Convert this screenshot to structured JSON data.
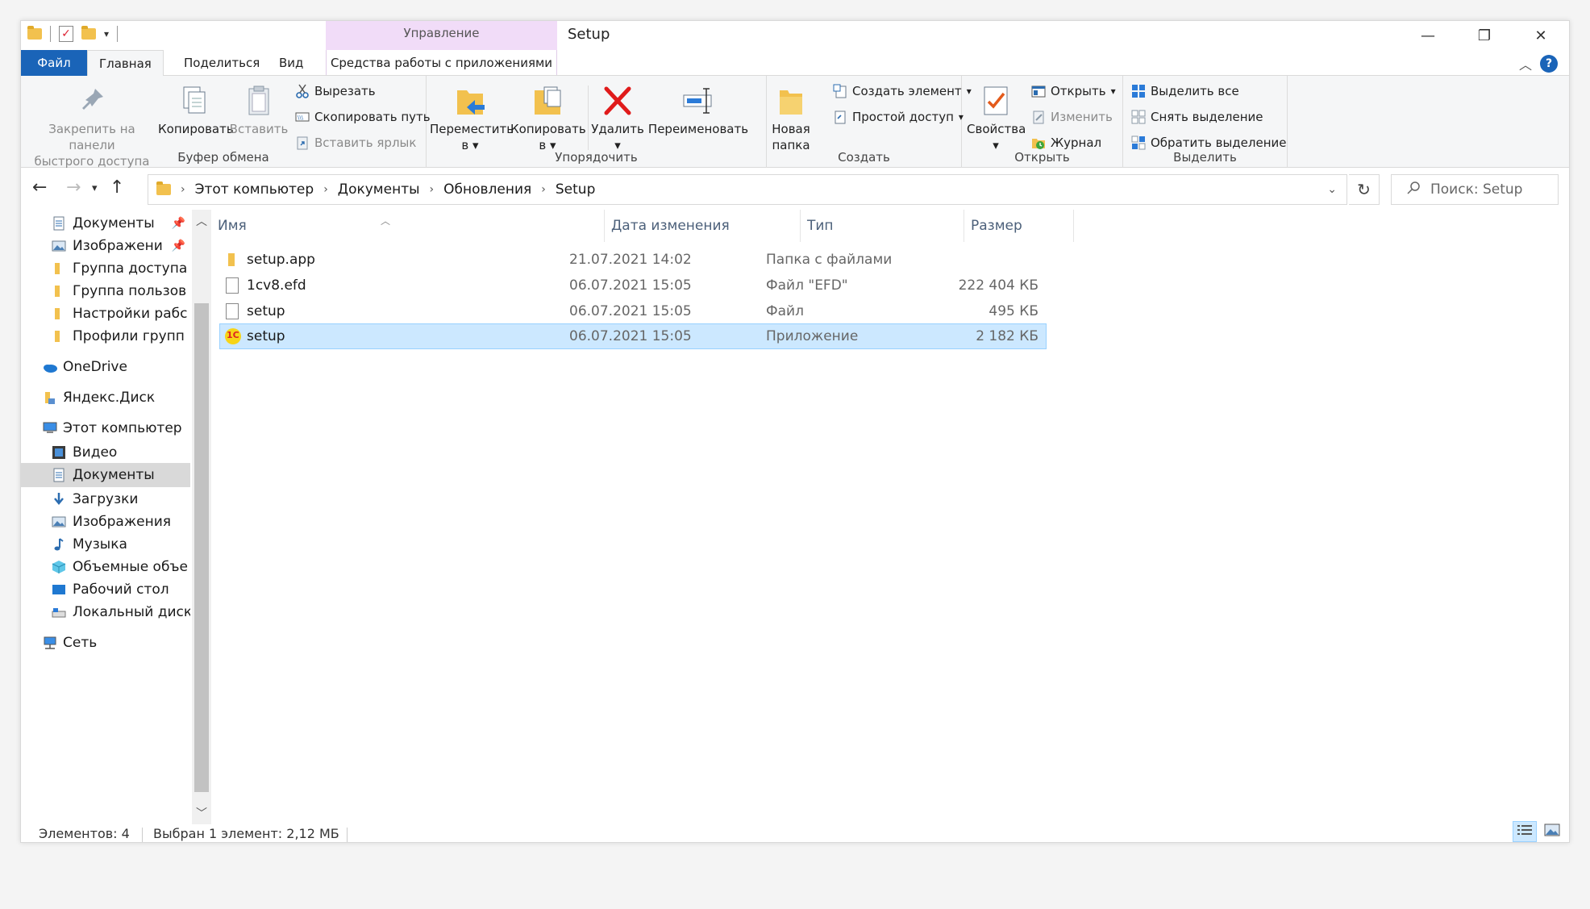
{
  "window": {
    "title": "Setup",
    "context_group_title": "Управление",
    "context_tab": "Средства работы с приложениями"
  },
  "tabs": [
    "Файл",
    "Главная",
    "Поделиться",
    "Вид"
  ],
  "ribbon": {
    "clipboard": {
      "label": "Буфер обмена",
      "pin": "Закрепить на панели быстрого доступа",
      "pin_l1": "Закрепить на панели",
      "pin_l2": "быстрого доступа",
      "copy": "Копировать",
      "paste": "Вставить",
      "cut": "Вырезать",
      "copy_path": "Скопировать путь",
      "paste_shortcut": "Вставить ярлык"
    },
    "organize": {
      "label": "Упорядочить",
      "move_l1": "Переместить",
      "move_l2": "в",
      "copy_l1": "Копировать",
      "copy_l2": "в",
      "delete": "Удалить",
      "rename": "Переименовать"
    },
    "create": {
      "label": "Создать",
      "new_folder_l1": "Новая",
      "new_folder_l2": "папка",
      "new_item": "Создать элемент",
      "easy_access": "Простой доступ"
    },
    "open": {
      "label": "Открыть",
      "properties": "Свойства",
      "open": "Открыть",
      "edit": "Изменить",
      "history": "Журнал"
    },
    "select": {
      "label": "Выделить",
      "select_all": "Выделить все",
      "select_none": "Снять выделение",
      "invert": "Обратить выделение"
    }
  },
  "address": {
    "crumbs": [
      "Этот компьютер",
      "Документы",
      "Обновления",
      "Setup"
    ],
    "search_placeholder": "Поиск: Setup"
  },
  "sidebar": {
    "items": [
      {
        "label": "Документы",
        "icon": "documents-icon",
        "pinned": true
      },
      {
        "label": "Изображени",
        "icon": "pictures-icon",
        "pinned": true
      },
      {
        "label": "Группа доступа",
        "icon": "folder-icon"
      },
      {
        "label": "Группа пользов",
        "icon": "folder-icon"
      },
      {
        "label": "Настройки рабс",
        "icon": "folder-icon"
      },
      {
        "label": "Профили групп",
        "icon": "folder-icon"
      },
      {
        "label": "OneDrive",
        "icon": "onedrive-icon"
      },
      {
        "label": "Яндекс.Диск",
        "icon": "yandex-disk-icon"
      },
      {
        "label": "Этот компьютер",
        "icon": "this-pc-icon"
      },
      {
        "label": "Видео",
        "icon": "video-icon"
      },
      {
        "label": "Документы",
        "icon": "documents-icon",
        "selected": true
      },
      {
        "label": "Загрузки",
        "icon": "downloads-icon"
      },
      {
        "label": "Изображения",
        "icon": "pictures-icon"
      },
      {
        "label": "Музыка",
        "icon": "music-icon"
      },
      {
        "label": "Объемные объе",
        "icon": "3d-objects-icon"
      },
      {
        "label": "Рабочий стол",
        "icon": "desktop-icon"
      },
      {
        "label": "Локальный диск",
        "icon": "local-disk-icon"
      },
      {
        "label": "Сеть",
        "icon": "network-icon"
      }
    ]
  },
  "filelist": {
    "columns": [
      "Имя",
      "Дата изменения",
      "Тип",
      "Размер"
    ],
    "rows": [
      {
        "name": "setup.app",
        "date": "21.07.2021 14:02",
        "type": "Папка с файлами",
        "size": "",
        "icon": "folder-icon"
      },
      {
        "name": "1cv8.efd",
        "date": "06.07.2021 15:05",
        "type": "Файл \"EFD\"",
        "size": "222 404 КБ",
        "icon": "file-icon"
      },
      {
        "name": "setup",
        "date": "06.07.2021 15:05",
        "type": "Файл",
        "size": "495 КБ",
        "icon": "file-icon"
      },
      {
        "name": "setup",
        "date": "06.07.2021 15:05",
        "type": "Приложение",
        "size": "2 182 КБ",
        "icon": "1c-app-icon",
        "selected": true
      }
    ]
  },
  "status": {
    "count": "Элементов: 4",
    "selection": "Выбран 1 элемент: 2,12 МБ"
  },
  "colors": {
    "accent": "#1a64b8",
    "context_tab": "#f1dcf8",
    "selection_bg": "#cce8ff",
    "selection_border": "#99d1ff",
    "folder": "#f2c14e"
  }
}
